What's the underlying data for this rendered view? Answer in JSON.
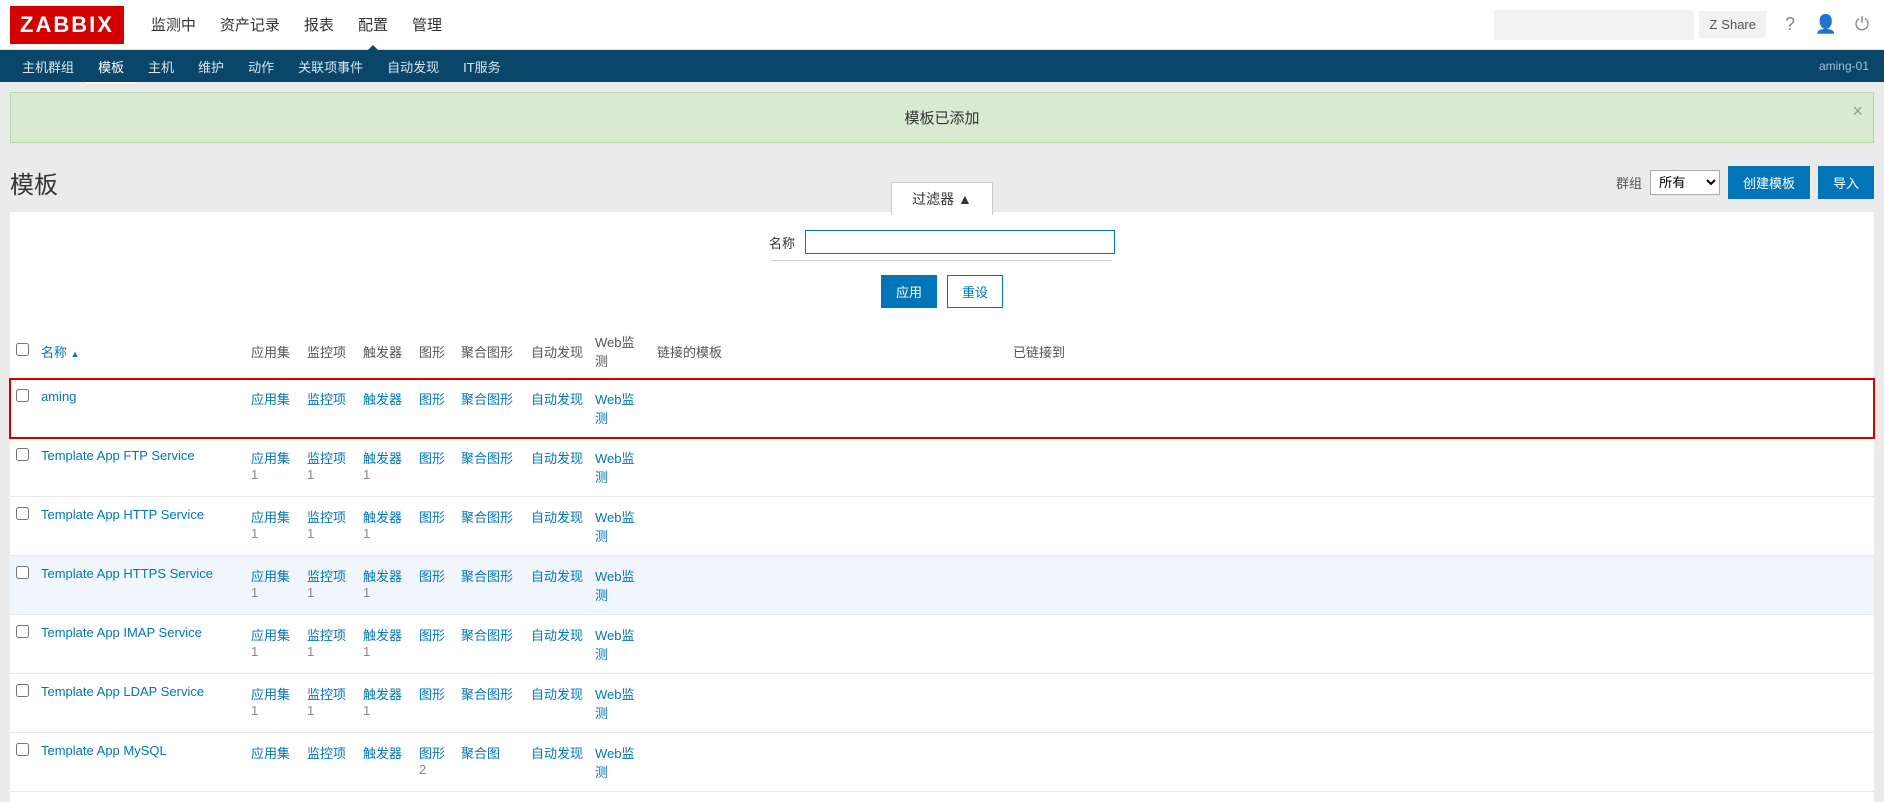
{
  "logo": "ZABBIX",
  "topMenu": [
    "监测中",
    "资产记录",
    "报表",
    "配置",
    "管理"
  ],
  "topMenuActive": 3,
  "share": "Share",
  "subMenu": [
    "主机群组",
    "模板",
    "主机",
    "维护",
    "动作",
    "关联项事件",
    "自动发现",
    "IT服务"
  ],
  "subMenuActive": 1,
  "hostLabel": "aming-01",
  "alert": "模板已添加",
  "pageTitle": "模板",
  "groupLabel": "群组",
  "groupSelected": "所有",
  "createBtn": "创建模板",
  "importBtn": "导入",
  "filterTab": "过滤器 ▲",
  "filterNameLabel": "名称",
  "filterApply": "应用",
  "filterReset": "重设",
  "headers": {
    "name": "名称",
    "sortArrow": "▲",
    "app": "应用集",
    "item": "监控项",
    "trigger": "触发器",
    "graph": "图形",
    "screen": "聚合图形",
    "discovery": "自动发现",
    "web": "Web监测",
    "linked": "链接的模板",
    "linkedTo": "已链接到"
  },
  "rows": [
    {
      "name": "aming",
      "app": "应用集",
      "appN": "",
      "item": "监控项",
      "itemN": "",
      "trig": "触发器",
      "trigN": "",
      "graph": "图形",
      "graphN": "",
      "screen": "聚合图形",
      "disc": "自动发现",
      "web": "Web监测",
      "hl": true
    },
    {
      "name": "Template App FTP Service",
      "app": "应用集",
      "appN": "1",
      "item": "监控项",
      "itemN": "1",
      "trig": "触发器",
      "trigN": "1",
      "graph": "图形",
      "graphN": "",
      "screen": "聚合图形",
      "disc": "自动发现",
      "web": "Web监测"
    },
    {
      "name": "Template App HTTP Service",
      "app": "应用集",
      "appN": "1",
      "item": "监控项",
      "itemN": "1",
      "trig": "触发器",
      "trigN": "1",
      "graph": "图形",
      "graphN": "",
      "screen": "聚合图形",
      "disc": "自动发现",
      "web": "Web监测"
    },
    {
      "name": "Template App HTTPS Service",
      "app": "应用集",
      "appN": "1",
      "item": "监控项",
      "itemN": "1",
      "trig": "触发器",
      "trigN": "1",
      "graph": "图形",
      "graphN": "",
      "screen": "聚合图形",
      "disc": "自动发现",
      "web": "Web监测",
      "alt": true
    },
    {
      "name": "Template App IMAP Service",
      "app": "应用集",
      "appN": "1",
      "item": "监控项",
      "itemN": "1",
      "trig": "触发器",
      "trigN": "1",
      "graph": "图形",
      "graphN": "",
      "screen": "聚合图形",
      "disc": "自动发现",
      "web": "Web监测"
    },
    {
      "name": "Template App LDAP Service",
      "app": "应用集",
      "appN": "1",
      "item": "监控项",
      "itemN": "1",
      "trig": "触发器",
      "trigN": "1",
      "graph": "图形",
      "graphN": "",
      "screen": "聚合图形",
      "disc": "自动发现",
      "web": "Web监测"
    },
    {
      "name": "Template App MySQL",
      "app": "应用集",
      "appN": "",
      "item": "监控项",
      "itemN": "",
      "trig": "触发器",
      "trigN": "",
      "graph": "图形",
      "graphN": "2",
      "screen": "聚合图",
      "disc": "自动发现",
      "web": "Web监测"
    }
  ]
}
